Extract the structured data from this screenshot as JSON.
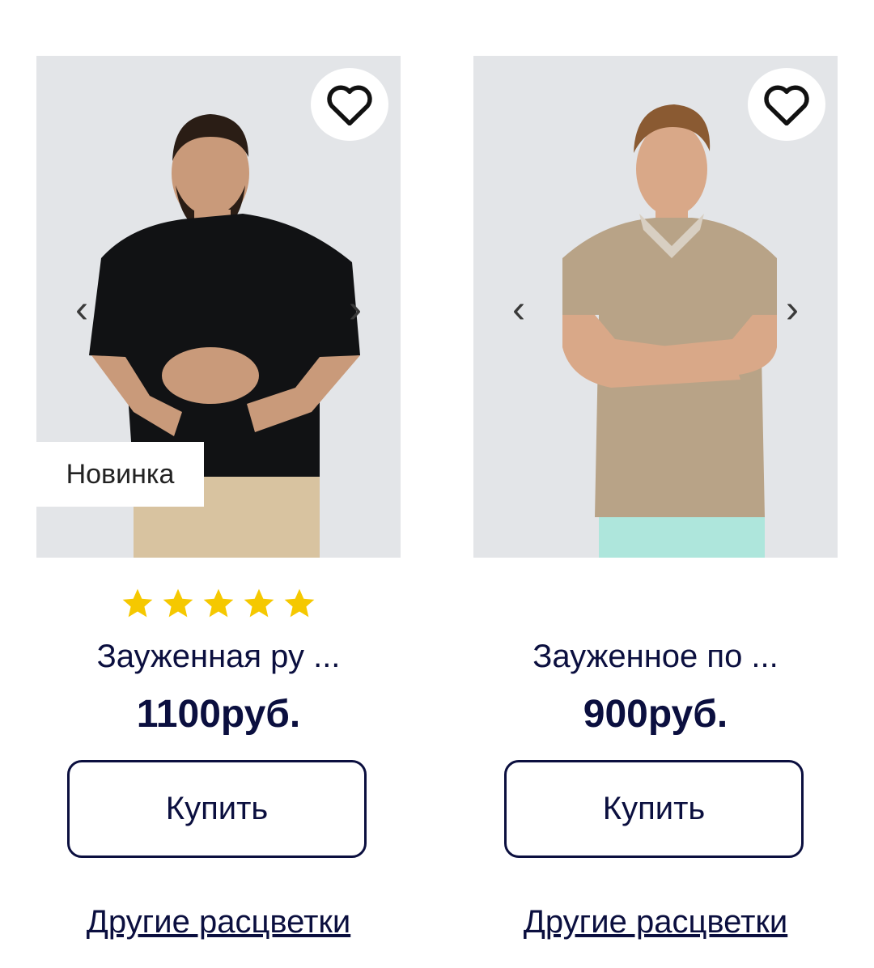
{
  "products": [
    {
      "badge": "Новинка",
      "rating": 5,
      "title": "Зауженная ру ...",
      "price": "1100руб.",
      "buy_label": "Купить",
      "colors_link": "Другие расцветки",
      "shirt_color": "#111214",
      "pants_color": "#d8c3a0"
    },
    {
      "badge": "",
      "rating": 0,
      "title": "Зауженное по ...",
      "price": "900руб.",
      "buy_label": "Купить",
      "colors_link": "Другие расцветки",
      "shirt_color": "#b8a387",
      "pants_color": "#aee6dc"
    }
  ],
  "carousel": {
    "prev_icon": "‹",
    "next_icon": "›"
  },
  "colors": {
    "text": "#0b0f3f",
    "star": "#f5c800",
    "photo_bg": "#e3e5e8"
  }
}
